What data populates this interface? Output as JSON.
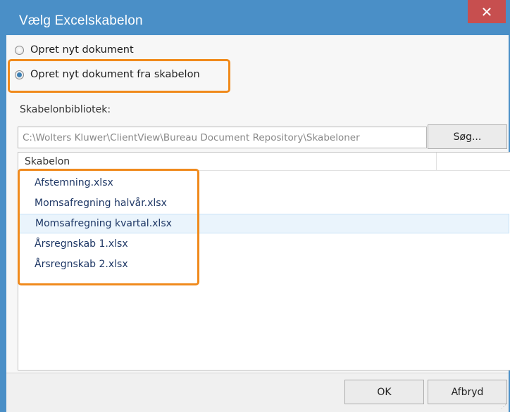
{
  "window": {
    "title": "Vælg Excelskabelon",
    "close_icon": "close-icon",
    "accent_color": "#4a8fc7",
    "close_color": "#c74f4f"
  },
  "options": [
    {
      "label": "Opret nyt dokument",
      "checked": false
    },
    {
      "label": "Opret nyt dokument fra skabelon",
      "checked": true
    }
  ],
  "library": {
    "label": "Skabelonbibliotek:",
    "path": "C:\\Wolters Kluwer\\ClientView\\Bureau Document Repository\\Skabeloner",
    "search_label": "Søg..."
  },
  "list": {
    "column": "Skabelon",
    "items": [
      "Afstemning.xlsx",
      "Momsafregning halvår.xlsx",
      "Momsafregning kvartal.xlsx",
      "Årsregnskab 1.xlsx",
      "Årsregnskab 2.xlsx"
    ],
    "selected_index": 2
  },
  "buttons": {
    "ok": "OK",
    "cancel": "Afbryd"
  },
  "highlight_color": "#f08a1c"
}
